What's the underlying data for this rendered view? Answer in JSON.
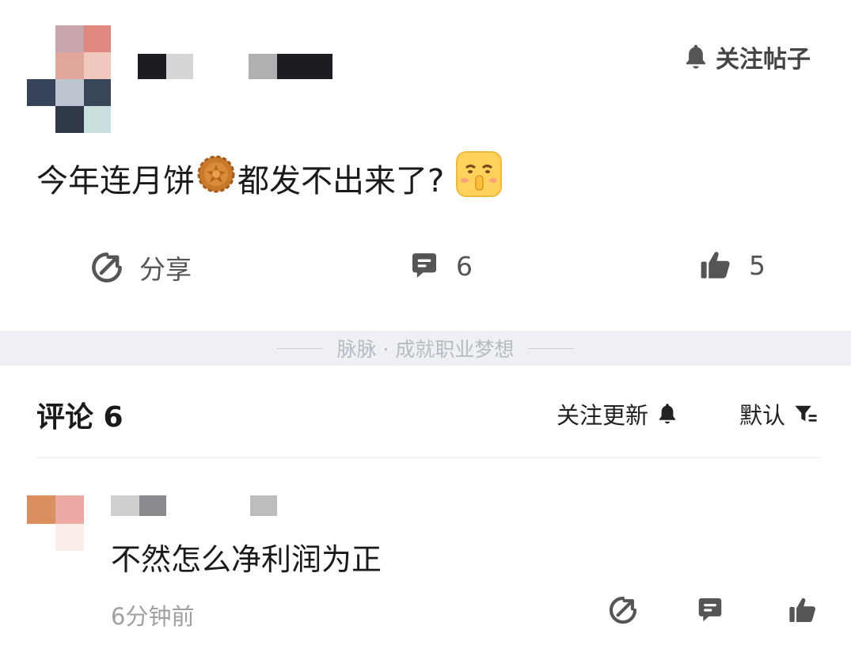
{
  "post": {
    "follow_post_label": "关注帖子",
    "text_before_emoji": "今年连月饼",
    "text_after_emoji": "都发不出来了?",
    "emoji_mooncake": "mooncake-emoji",
    "emoji_shush": "shush-face-emoji"
  },
  "actions": {
    "share_label": "分享",
    "comment_count": "6",
    "like_count": "5"
  },
  "divider": {
    "slogan": "脉脉 · 成就职业梦想"
  },
  "comments": {
    "title": "评论 6",
    "follow_updates_label": "关注更新",
    "sort_label": "默认",
    "items": [
      {
        "text": "不然怎么净利润为正",
        "time": "6分钟前"
      }
    ]
  },
  "colors": {
    "icon_gray": "#555555",
    "divider_bg": "#eef0f3",
    "muted_text": "#a0a0a0"
  }
}
